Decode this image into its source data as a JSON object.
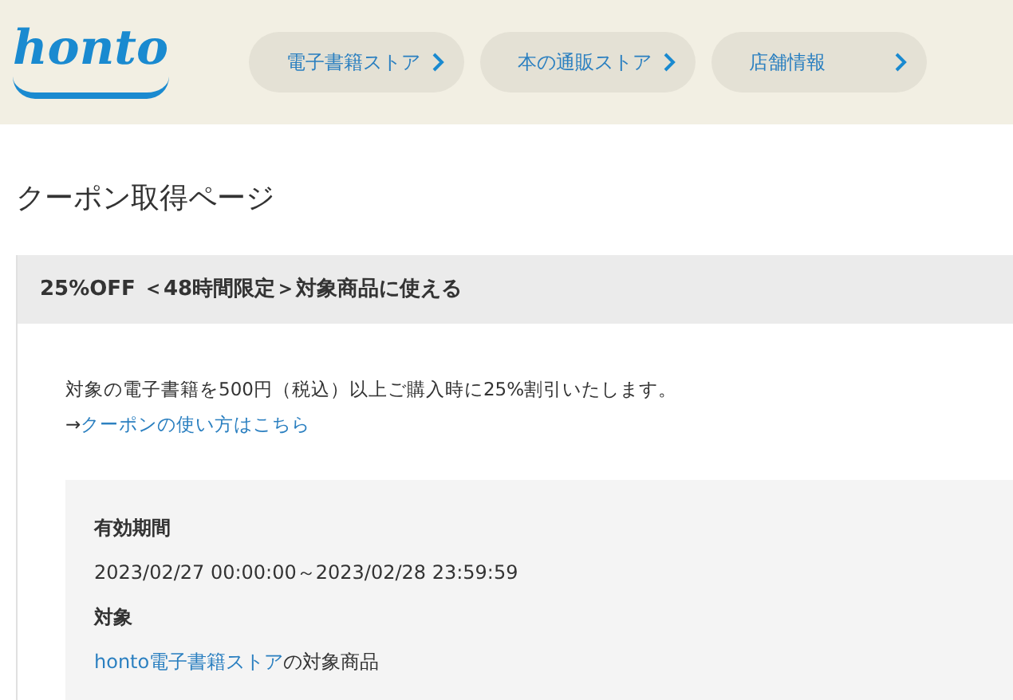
{
  "header": {
    "logo": "honto",
    "nav": [
      {
        "label": "電子書籍ストア"
      },
      {
        "label": "本の通販ストア"
      },
      {
        "label": "店舗情報"
      }
    ]
  },
  "page_title": "クーポン取得ページ",
  "coupon": {
    "title": "25%OFF ＜48時間限定＞対象商品に使える",
    "description": "対象の電子書籍を500円（税込）以上ご購入時に25%割引いたします。",
    "link_prefix": "→",
    "link": "クーポンの使い方はこちら",
    "details": [
      {
        "label": "有効期間",
        "value": "2023/02/27 00:00:00～2023/02/28 23:59:59"
      },
      {
        "label": "対象",
        "value_link": "honto電子書籍ストア",
        "value": "の対象商品"
      }
    ]
  }
}
